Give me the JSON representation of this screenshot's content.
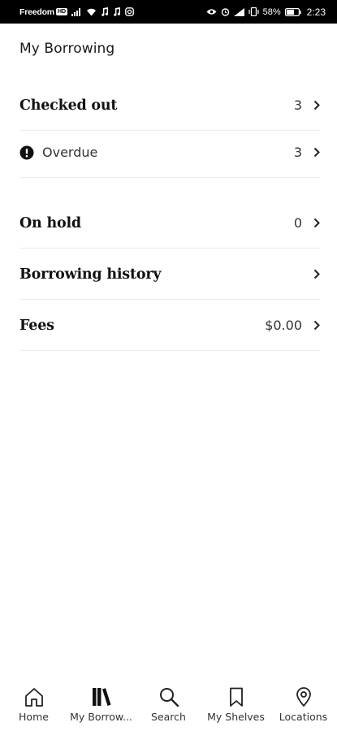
{
  "status_bar": {
    "carrier": "Freedom",
    "carrier_badge": "HD",
    "battery_percent": "58%",
    "time": "2:23"
  },
  "page": {
    "title": "My Borrowing"
  },
  "rows": {
    "checked_out": {
      "label": "Checked out",
      "value": "3"
    },
    "overdue": {
      "label": "Overdue",
      "value": "3"
    },
    "on_hold": {
      "label": "On hold",
      "value": "0"
    },
    "borrowing_history": {
      "label": "Borrowing history"
    },
    "fees": {
      "label": "Fees",
      "value": "$0.00"
    }
  },
  "bottom_nav": {
    "items": [
      {
        "label": "Home",
        "icon": "home-icon"
      },
      {
        "label": "My Borrow...",
        "icon": "books-icon"
      },
      {
        "label": "Search",
        "icon": "search-icon"
      },
      {
        "label": "My Shelves",
        "icon": "bookmark-icon"
      },
      {
        "label": "Locations",
        "icon": "location-pin-icon"
      }
    ]
  }
}
